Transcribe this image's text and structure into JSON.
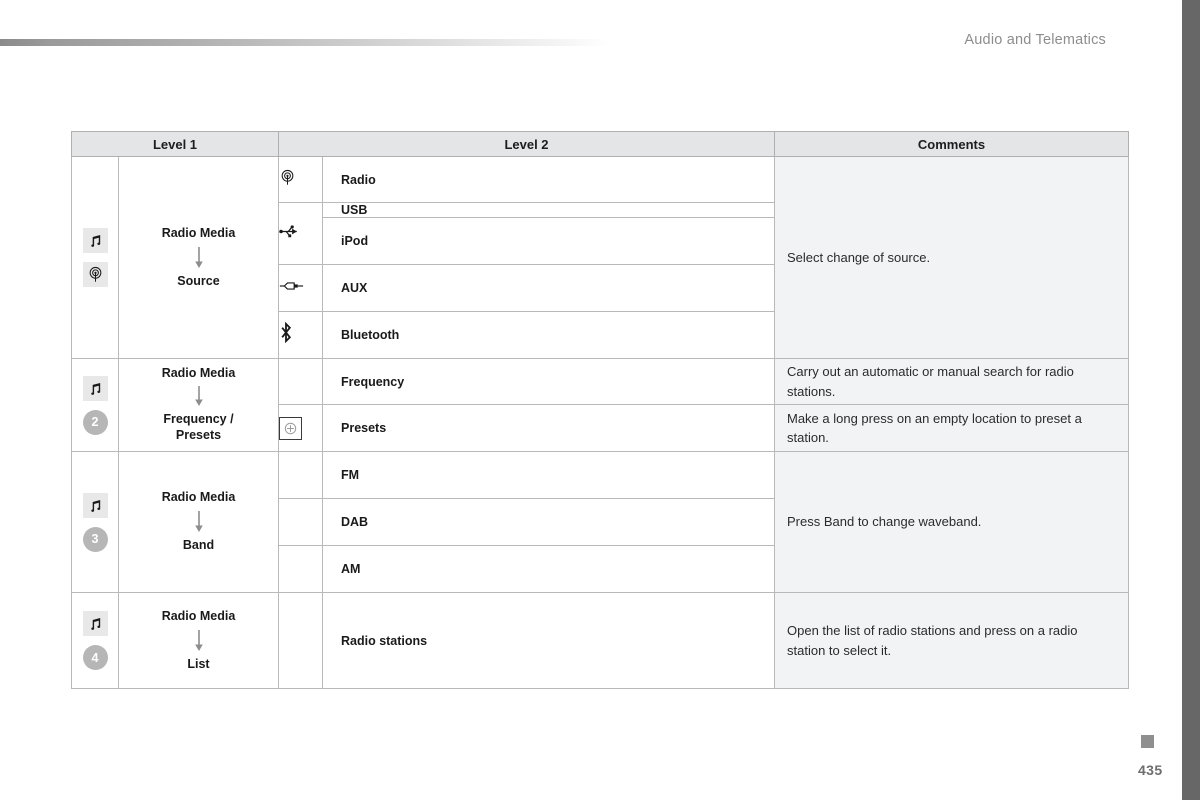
{
  "running_head": "Audio and Telematics",
  "page_number": "435",
  "colors": {
    "header_bg": "#e4e5e7",
    "comments_bg": "#f2f3f4",
    "edge_bar": "#676767",
    "badge_bg": "#b6b6b6",
    "icon_tile_bg": "#e8e8e8",
    "border": "#b9b9b9"
  },
  "table": {
    "headers": [
      "Level 1",
      "Level 2",
      "Comments"
    ],
    "sections": [
      {
        "level1": {
          "icons": [
            "music-note-icon",
            "radio-antenna-icon"
          ],
          "title": "Radio Media",
          "arrow": "down-arrow-icon",
          "subtitle": "Source"
        },
        "rows": [
          {
            "icon": "radio-antenna-icon",
            "label": "Radio"
          },
          {
            "icon": "usb-icon",
            "label": "USB"
          },
          {
            "icon": "",
            "label": "iPod"
          },
          {
            "icon": "aux-jack-icon",
            "label": "AUX"
          },
          {
            "icon": "bluetooth-icon",
            "label": "Bluetooth"
          }
        ],
        "comment": "Select change of source."
      },
      {
        "level1": {
          "icons": [
            "music-note-icon",
            "2"
          ],
          "title": "Radio Media",
          "arrow": "down-arrow-icon",
          "subtitle": "Frequency /\nPresets",
          "subtitle_line1": "Frequency /",
          "subtitle_line2": "Presets"
        },
        "rows": [
          {
            "icon": "",
            "label": "Frequency",
            "comment": "Carry out an automatic or manual search for radio stations."
          },
          {
            "icon": "preset-add-icon",
            "label": "Presets",
            "comment": "Make a long press on an empty location to preset a station."
          }
        ]
      },
      {
        "level1": {
          "icons": [
            "music-note-icon",
            "3"
          ],
          "title": "Radio Media",
          "arrow": "down-arrow-icon",
          "subtitle": "Band"
        },
        "rows": [
          {
            "icon": "",
            "label": "FM"
          },
          {
            "icon": "",
            "label": "DAB"
          },
          {
            "icon": "",
            "label": "AM"
          }
        ],
        "comment": "Press Band to change waveband."
      },
      {
        "level1": {
          "icons": [
            "music-note-icon",
            "4"
          ],
          "title": "Radio Media",
          "arrow": "down-arrow-icon",
          "subtitle": "List"
        },
        "rows": [
          {
            "icon": "",
            "label": "Radio stations"
          }
        ],
        "comment": "Open the list of radio stations and press on a radio station to select it."
      }
    ]
  }
}
